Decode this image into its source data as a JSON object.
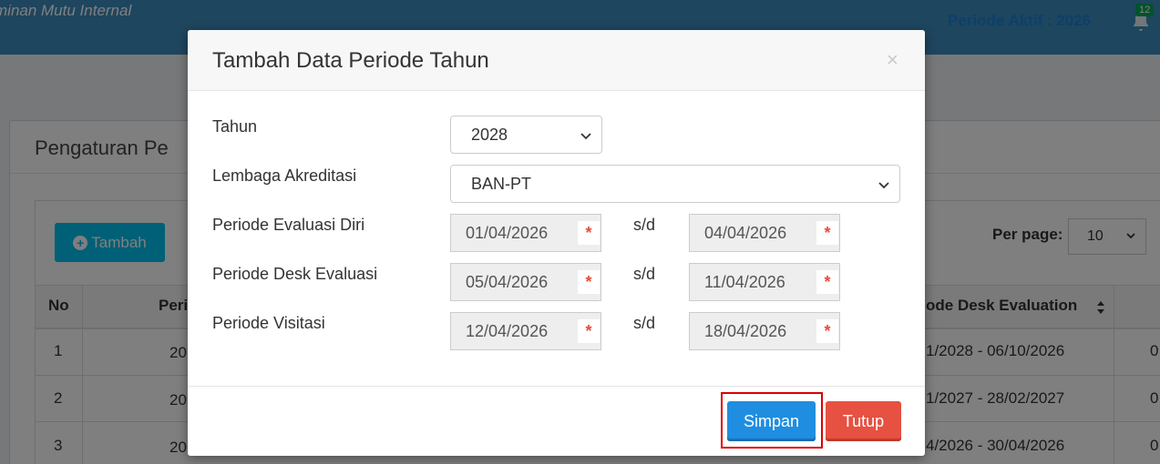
{
  "header": {
    "app_title": "minan Mutu Internal",
    "active_period": "Periode Aktif : 2026",
    "notification_count": "12"
  },
  "background": {
    "panel_title": "Pengaturan Pe",
    "add_button": "Tambah",
    "per_page_label": "Per page:",
    "per_page_value": "10",
    "columns": {
      "no": "No",
      "period_partial": "Peri",
      "desk_evaluation": "ode Desk Evaluation"
    },
    "rows": [
      {
        "no": "1",
        "period_partial": "20",
        "desk_evaluation": "1/2028 - 06/10/2026",
        "trailing": "0"
      },
      {
        "no": "2",
        "period_partial": "20",
        "desk_evaluation": "1/2027 - 28/02/2027",
        "trailing": "0"
      },
      {
        "no": "3",
        "period_partial": "20",
        "desk_evaluation": "4/2026 - 30/04/2026",
        "trailing": "0"
      }
    ]
  },
  "modal": {
    "title": "Tambah Data Periode Tahun",
    "close": "×",
    "fields": {
      "tahun": {
        "label": "Tahun",
        "value": "2028"
      },
      "lembaga": {
        "label": "Lembaga Akreditasi",
        "value": "BAN-PT"
      },
      "evaluasi_diri": {
        "label": "Periode Evaluasi Diri",
        "start": "01/04/2026",
        "end": "04/04/2026"
      },
      "desk_evaluasi": {
        "label": "Periode Desk Evaluasi",
        "start": "05/04/2026",
        "end": "11/04/2026"
      },
      "visitasi": {
        "label": "Periode Visitasi",
        "start": "12/04/2026",
        "end": "18/04/2026"
      }
    },
    "range_separator": "s/d",
    "required_mark": "*",
    "buttons": {
      "save": "Simpan",
      "close": "Tutup"
    }
  },
  "colors": {
    "primary": "#1f8ee0",
    "danger": "#e65142",
    "highlight": "#dd0000",
    "required": "#e74c3c"
  }
}
